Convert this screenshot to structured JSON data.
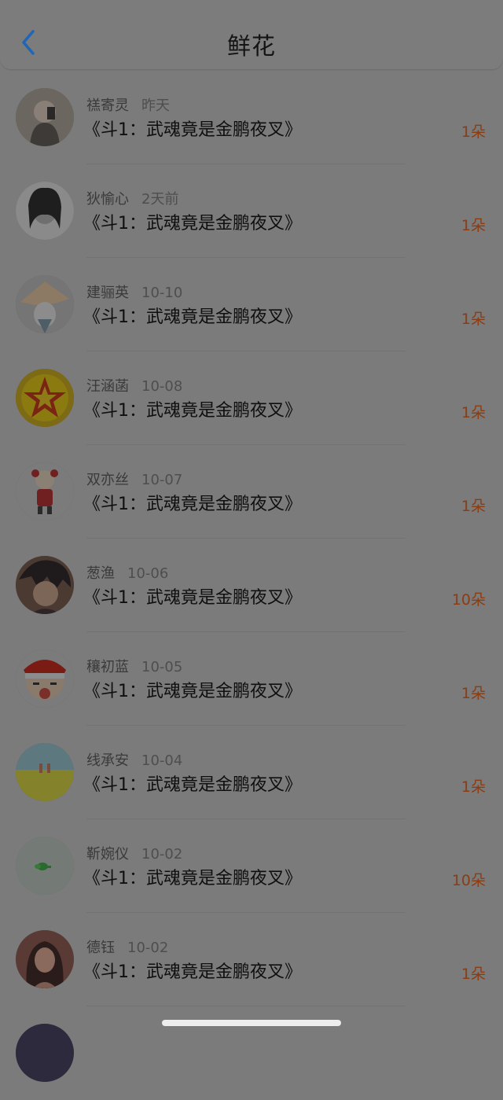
{
  "nav": {
    "title": "鲜花",
    "back_icon": "chevron-left-icon",
    "accent": "#1f66b7"
  },
  "list": [
    {
      "name": "禚寄灵",
      "time": "昨天",
      "book": "《斗1：武魂竟是金鹏夜叉》",
      "count": "1朵",
      "avatar": "photo-woman-selfie"
    },
    {
      "name": "狄愉心",
      "time": "2天前",
      "book": "《斗1：武魂竟是金鹏夜叉》",
      "count": "1朵",
      "avatar": "bw-woman-portrait"
    },
    {
      "name": "建骊英",
      "time": "10-10",
      "book": "《斗1：武魂竟是金鹏夜叉》",
      "count": "1朵",
      "avatar": "anime-character"
    },
    {
      "name": "汪涵菡",
      "time": "10-08",
      "book": "《斗1：武魂竟是金鹏夜叉》",
      "count": "1朵",
      "avatar": "red-star-badge"
    },
    {
      "name": "双亦丝",
      "time": "10-07",
      "book": "《斗1：武魂竟是金鹏夜叉》",
      "count": "1朵",
      "avatar": "cartoon-sheep"
    },
    {
      "name": "葱渔",
      "time": "10-06",
      "book": "《斗1：武魂竟是金鹏夜叉》",
      "count": "10朵",
      "avatar": "anime-boy"
    },
    {
      "name": "穰初蓝",
      "time": "10-05",
      "book": "《斗1：武魂竟是金鹏夜叉》",
      "count": "1朵",
      "avatar": "cartoon-pirate"
    },
    {
      "name": "线承安",
      "time": "10-04",
      "book": "《斗1：武魂竟是金鹏夜叉》",
      "count": "1朵",
      "avatar": "landscape-field"
    },
    {
      "name": "靳婉仪",
      "time": "10-02",
      "book": "《斗1：武魂竟是金鹏夜叉》",
      "count": "10朵",
      "avatar": "green-figure"
    },
    {
      "name": "德钰",
      "time": "10-02",
      "book": "《斗1：武魂竟是金鹏夜叉》",
      "count": "1朵",
      "avatar": "photo-girl"
    }
  ],
  "colors": {
    "count": "#8a3c12",
    "overlay_bg": "#7b7b7b"
  }
}
